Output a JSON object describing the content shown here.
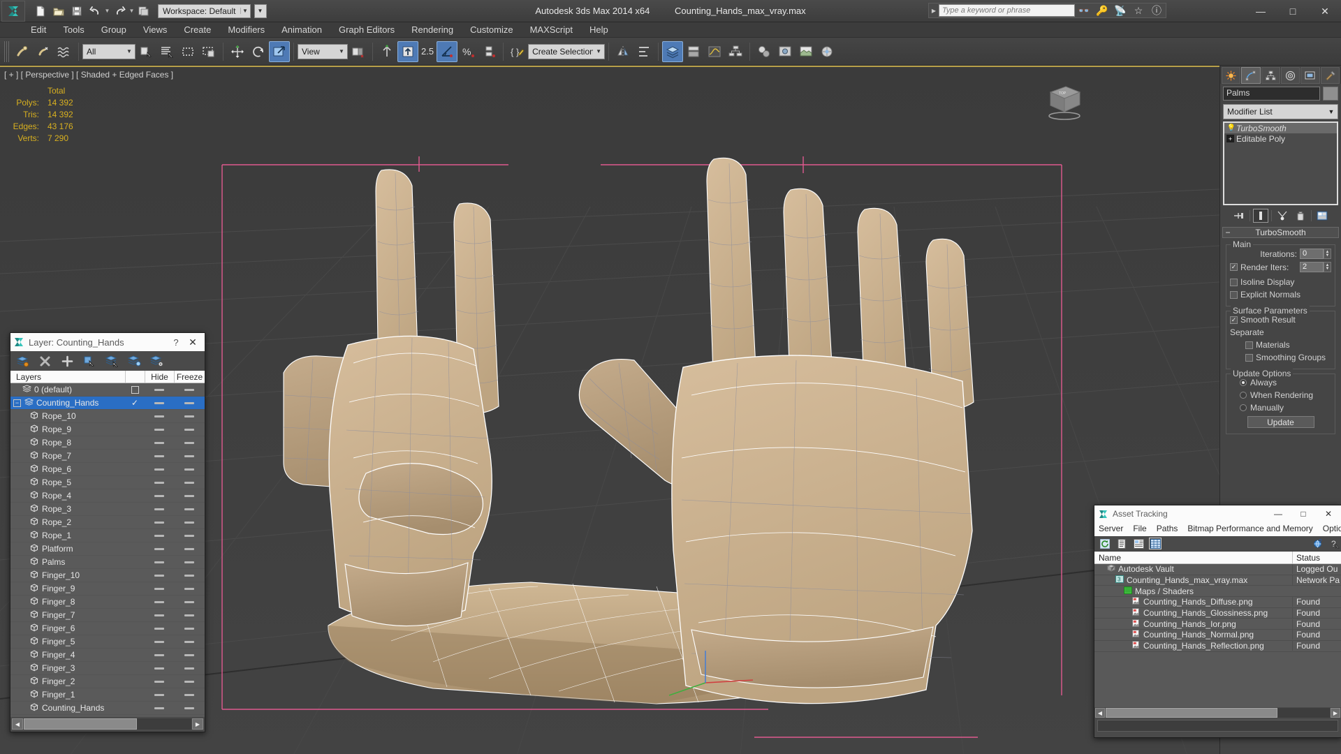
{
  "titlebar": {
    "workspace_label": "Workspace: Default",
    "app_title": "Autodesk 3ds Max  2014 x64",
    "file_title": "Counting_Hands_max_vray.max",
    "search_placeholder": "Type a keyword or phrase",
    "quick_access": [
      "new-icon",
      "open-icon",
      "save-icon",
      "undo-icon",
      "redo-icon",
      "set-project-icon"
    ],
    "window_buttons": [
      "minimize",
      "maximize",
      "close"
    ]
  },
  "menubar": {
    "items": [
      "Edit",
      "Tools",
      "Group",
      "Views",
      "Create",
      "Modifiers",
      "Animation",
      "Graph Editors",
      "Rendering",
      "Customize",
      "MAXScript",
      "Help"
    ]
  },
  "toolbar": {
    "selection_filter": "All",
    "ref_coord_system": "View",
    "named_selection_sets": "Create Selection Se",
    "snap_value": "2.5"
  },
  "viewport": {
    "label": "[ + ] [ Perspective ] [ Shaded + Edged Faces ]",
    "stats": {
      "header": "Total",
      "rows": [
        {
          "label": "Polys:",
          "value": "14 392"
        },
        {
          "label": "Tris:",
          "value": "14 392"
        },
        {
          "label": "Edges:",
          "value": "43 176"
        },
        {
          "label": "Verts:",
          "value": "7 290"
        }
      ]
    },
    "view_cube_label": "TOP"
  },
  "command_panel": {
    "tabs": [
      "create-tab",
      "modify-tab",
      "hierarchy-tab",
      "motion-tab",
      "display-tab",
      "utilities-tab"
    ],
    "active_tab_index": 1,
    "object_name": "Palms",
    "modifier_list_label": "Modifier List",
    "stack": [
      {
        "label": "TurboSmooth",
        "selected": true,
        "italic": true
      },
      {
        "label": "Editable Poly",
        "selected": false,
        "italic": false
      }
    ],
    "stack_buttons": [
      "pin-stack-icon",
      "show-end-result-icon",
      "make-unique-icon",
      "remove-modifier-icon",
      "configure-sets-icon"
    ],
    "rollout": {
      "title": "TurboSmooth",
      "main_group": "Main",
      "iterations_label": "Iterations:",
      "iterations_value": "0",
      "render_iters_label": "Render Iters:",
      "render_iters_value": "2",
      "render_iters_checked": true,
      "isoline_display": "Isoline Display",
      "isoline_checked": false,
      "explicit_normals": "Explicit Normals",
      "explicit_checked": false,
      "surface_group": "Surface Parameters",
      "smooth_result": "Smooth Result",
      "smooth_checked": true,
      "separate_label": "Separate",
      "materials": "Materials",
      "materials_checked": false,
      "smoothing_groups": "Smoothing Groups",
      "smoothing_groups_checked": false,
      "update_group": "Update Options",
      "update_options": [
        "Always",
        "When Rendering",
        "Manually"
      ],
      "update_selected": 0,
      "update_button": "Update"
    }
  },
  "layer_dialog": {
    "title": "Layer: Counting_Hands",
    "help_glyph": "?",
    "close_glyph": "✕",
    "toolbar_icons": [
      "create-new-layer-icon",
      "delete-layer-icon",
      "add-layer-icon",
      "select-objects-icon",
      "select-highlighted-icon",
      "highlight-selected-icon",
      "layer-properties-icon"
    ],
    "columns": [
      "Layers",
      "",
      "Hide",
      "Freeze"
    ],
    "rows": [
      {
        "name": "0 (default)",
        "indent": 1,
        "icon": "layer-icon",
        "selected": false,
        "check": "empty-box",
        "hide": true,
        "freeze": true
      },
      {
        "name": "Counting_Hands",
        "indent": 0,
        "icon": "layer-icon",
        "selected": true,
        "check": "check",
        "hide": true,
        "freeze": true,
        "expander": "−"
      },
      {
        "name": "Rope_10",
        "indent": 2,
        "icon": "object-icon",
        "selected": false,
        "hide": true,
        "freeze": true
      },
      {
        "name": "Rope_9",
        "indent": 2,
        "icon": "object-icon",
        "selected": false,
        "hide": true,
        "freeze": true
      },
      {
        "name": "Rope_8",
        "indent": 2,
        "icon": "object-icon",
        "selected": false,
        "hide": true,
        "freeze": true
      },
      {
        "name": "Rope_7",
        "indent": 2,
        "icon": "object-icon",
        "selected": false,
        "hide": true,
        "freeze": true
      },
      {
        "name": "Rope_6",
        "indent": 2,
        "icon": "object-icon",
        "selected": false,
        "hide": true,
        "freeze": true
      },
      {
        "name": "Rope_5",
        "indent": 2,
        "icon": "object-icon",
        "selected": false,
        "hide": true,
        "freeze": true
      },
      {
        "name": "Rope_4",
        "indent": 2,
        "icon": "object-icon",
        "selected": false,
        "hide": true,
        "freeze": true
      },
      {
        "name": "Rope_3",
        "indent": 2,
        "icon": "object-icon",
        "selected": false,
        "hide": true,
        "freeze": true
      },
      {
        "name": "Rope_2",
        "indent": 2,
        "icon": "object-icon",
        "selected": false,
        "hide": true,
        "freeze": true
      },
      {
        "name": "Rope_1",
        "indent": 2,
        "icon": "object-icon",
        "selected": false,
        "hide": true,
        "freeze": true
      },
      {
        "name": "Platform",
        "indent": 2,
        "icon": "object-icon",
        "selected": false,
        "hide": true,
        "freeze": true
      },
      {
        "name": "Palms",
        "indent": 2,
        "icon": "object-icon",
        "selected": false,
        "hide": true,
        "freeze": true
      },
      {
        "name": "Finger_10",
        "indent": 2,
        "icon": "object-icon",
        "selected": false,
        "hide": true,
        "freeze": true
      },
      {
        "name": "Finger_9",
        "indent": 2,
        "icon": "object-icon",
        "selected": false,
        "hide": true,
        "freeze": true
      },
      {
        "name": "Finger_8",
        "indent": 2,
        "icon": "object-icon",
        "selected": false,
        "hide": true,
        "freeze": true
      },
      {
        "name": "Finger_7",
        "indent": 2,
        "icon": "object-icon",
        "selected": false,
        "hide": true,
        "freeze": true
      },
      {
        "name": "Finger_6",
        "indent": 2,
        "icon": "object-icon",
        "selected": false,
        "hide": true,
        "freeze": true
      },
      {
        "name": "Finger_5",
        "indent": 2,
        "icon": "object-icon",
        "selected": false,
        "hide": true,
        "freeze": true
      },
      {
        "name": "Finger_4",
        "indent": 2,
        "icon": "object-icon",
        "selected": false,
        "hide": true,
        "freeze": true
      },
      {
        "name": "Finger_3",
        "indent": 2,
        "icon": "object-icon",
        "selected": false,
        "hide": true,
        "freeze": true
      },
      {
        "name": "Finger_2",
        "indent": 2,
        "icon": "object-icon",
        "selected": false,
        "hide": true,
        "freeze": true
      },
      {
        "name": "Finger_1",
        "indent": 2,
        "icon": "object-icon",
        "selected": false,
        "hide": true,
        "freeze": true
      },
      {
        "name": "Counting_Hands",
        "indent": 2,
        "icon": "object-icon",
        "selected": false,
        "hide": true,
        "freeze": true
      }
    ]
  },
  "asset_tracking": {
    "title": "Asset Tracking",
    "menu": [
      "Server",
      "File",
      "Paths",
      "Bitmap Performance and Memory",
      "Options"
    ],
    "toolbar_icons": [
      "refresh-icon",
      "list-view-icon",
      "detail-view-icon",
      "grid-view-icon",
      "help-web-icon",
      "help-icon"
    ],
    "columns": [
      "Name",
      "Status"
    ],
    "rows": [
      {
        "name": "Autodesk Vault",
        "status": "Logged Ou",
        "indent": 1,
        "icon": "vault-icon"
      },
      {
        "name": "Counting_Hands_max_vray.max",
        "status": "Network Pa",
        "indent": 2,
        "icon": "max-file-icon"
      },
      {
        "name": "Maps / Shaders",
        "status": "",
        "indent": 3,
        "icon": "maps-icon"
      },
      {
        "name": "Counting_Hands_Diffuse.png",
        "status": "Found",
        "indent": 4,
        "icon": "bitmap-icon"
      },
      {
        "name": "Counting_Hands_Glossiness.png",
        "status": "Found",
        "indent": 4,
        "icon": "bitmap-icon"
      },
      {
        "name": "Counting_Hands_Ior.png",
        "status": "Found",
        "indent": 4,
        "icon": "bitmap-icon"
      },
      {
        "name": "Counting_Hands_Normal.png",
        "status": "Found",
        "indent": 4,
        "icon": "bitmap-icon"
      },
      {
        "name": "Counting_Hands_Reflection.png",
        "status": "Found",
        "indent": 4,
        "icon": "bitmap-icon"
      }
    ]
  },
  "colors": {
    "accent": "#2a6ec4",
    "stats_text": "#d8b020",
    "viewport_bg": "#3f3f3f",
    "model_fill": "#cbb293",
    "highlight_edge": "#ffffff",
    "gizmo_pink": "#e05a8f"
  }
}
